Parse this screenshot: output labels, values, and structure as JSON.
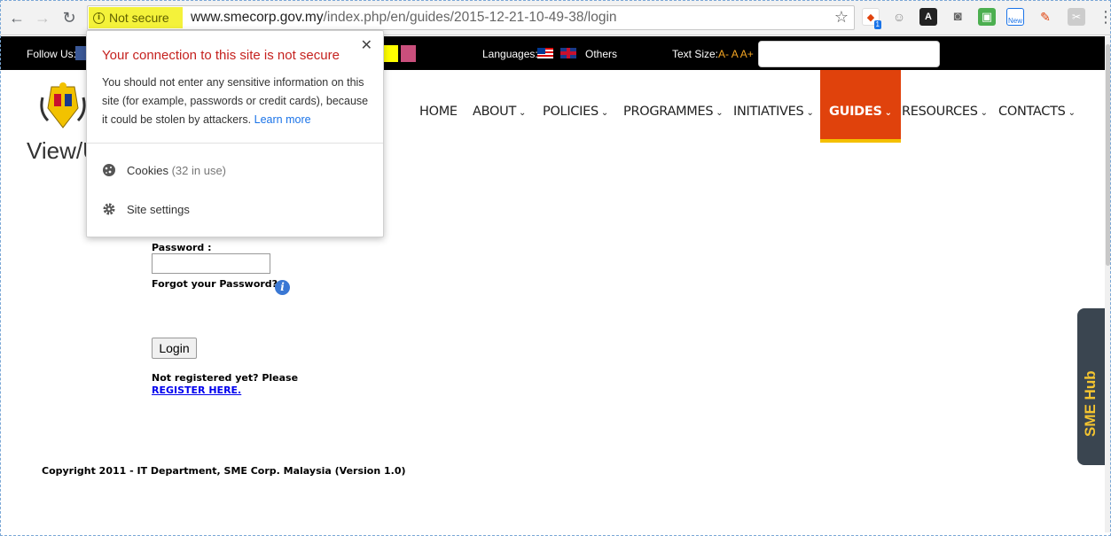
{
  "browser": {
    "security_chip": "Not secure",
    "url_host": "www.smecorp.gov.my",
    "url_path": "/index.php/en/guides/2015-12-21-10-49-38/login",
    "extensions": [
      {
        "name": "extension-badge",
        "badge": "1"
      },
      {
        "name": "extension-new",
        "badge": "New"
      }
    ]
  },
  "topbar": {
    "follow_label": "Follow Us:",
    "languages_label": "Languages:",
    "others_label": "Others",
    "textsize_label": "Text Size:",
    "textsize_options": [
      "A-",
      "A",
      "A+"
    ],
    "swatch_colors": [
      "#ffff00",
      "#c94f7c"
    ]
  },
  "heading": "View/U",
  "nav": {
    "items": [
      {
        "label": "HOME",
        "dropdown": false
      },
      {
        "label": "ABOUT",
        "dropdown": true
      },
      {
        "label": "POLICIES",
        "dropdown": true
      },
      {
        "label": "PROGRAMMES",
        "dropdown": true
      },
      {
        "label": "INITIATIVES",
        "dropdown": true
      },
      {
        "label": "GUIDES",
        "dropdown": true,
        "active": true
      },
      {
        "label": "RESOURCES",
        "dropdown": true
      },
      {
        "label": "CONTACTS",
        "dropdown": true
      }
    ],
    "active_color": "#e0420c",
    "active_underline": "#f4c000"
  },
  "form": {
    "password_label": "Password :",
    "password_value": "",
    "forgot_label": "Forgot your Password?",
    "login_button": "Login",
    "not_registered": "Not registered yet? Please",
    "register_link": "REGISTER HERE."
  },
  "copyright": "Copyright 2011 - IT Department, SME Corp. Malaysia (Version 1.0)",
  "side_tab": "SME Hub",
  "popup": {
    "title": "Your connection to this site is not secure",
    "body": "You should not enter any sensitive information on this site (for example, passwords or credit cards), because it could be stolen by attackers.",
    "learn_more": "Learn more",
    "cookies_label": "Cookies",
    "cookies_count": "(32 in use)",
    "site_settings_label": "Site settings",
    "close_glyph": "✕"
  }
}
